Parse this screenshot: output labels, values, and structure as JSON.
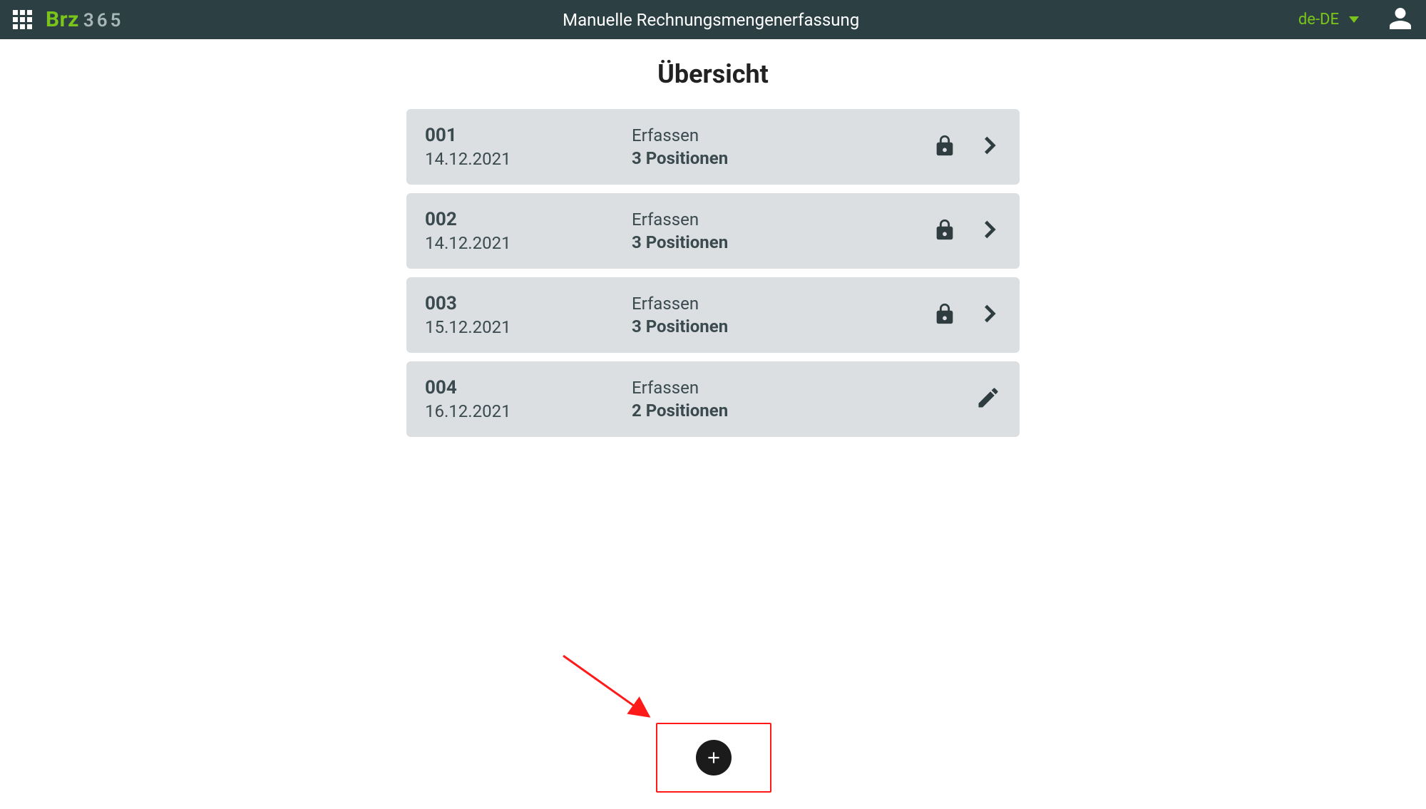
{
  "header": {
    "app_title": "Manuelle Rechnungsmengenerfassung",
    "language": "de-DE",
    "logo_main": "Brz",
    "logo_sub": "365"
  },
  "page": {
    "heading": "Übersicht"
  },
  "rows": [
    {
      "id": "001",
      "date": "14.12.2021",
      "status": "Erfassen",
      "positions": "3 Positionen",
      "locked": true,
      "editable": false
    },
    {
      "id": "002",
      "date": "14.12.2021",
      "status": "Erfassen",
      "positions": "3 Positionen",
      "locked": true,
      "editable": false
    },
    {
      "id": "003",
      "date": "15.12.2021",
      "status": "Erfassen",
      "positions": "3 Positionen",
      "locked": true,
      "editable": false
    },
    {
      "id": "004",
      "date": "16.12.2021",
      "status": "Erfassen",
      "positions": "2 Positionen",
      "locked": false,
      "editable": true
    }
  ]
}
